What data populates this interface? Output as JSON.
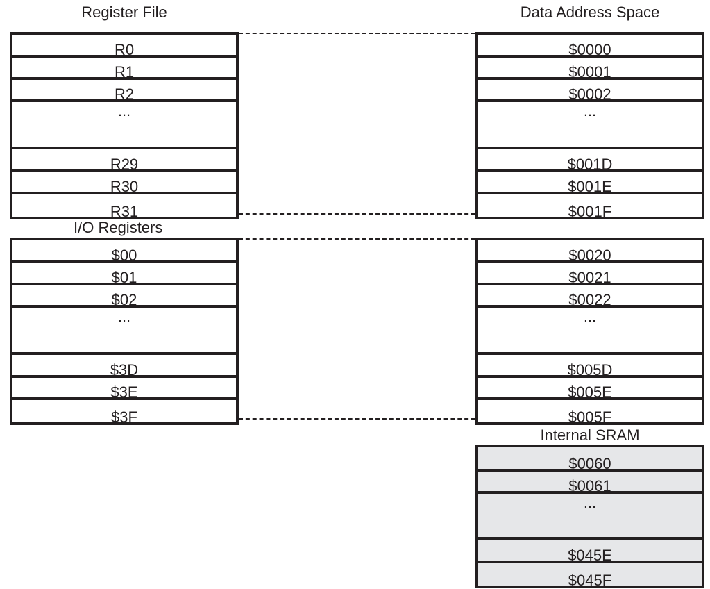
{
  "register_file": {
    "title": "Register File",
    "rows": [
      "R0",
      "R1",
      "R2",
      "...",
      "R29",
      "R30",
      "R31"
    ]
  },
  "io_registers": {
    "title": "I/O Registers",
    "rows": [
      "$00",
      "$01",
      "$02",
      "...",
      "$3D",
      "$3E",
      "$3F"
    ]
  },
  "data_address_space": {
    "title": "Data Address Space",
    "register_rows": [
      "$0000",
      "$0001",
      "$0002",
      "...",
      "$001D",
      "$001E",
      "$001F"
    ],
    "io_rows": [
      "$0020",
      "$0021",
      "$0022",
      "...",
      "$005D",
      "$005E",
      "$005F"
    ]
  },
  "internal_sram": {
    "title": "Internal SRAM",
    "rows": [
      "$0060",
      "$0061",
      "...",
      "$045E",
      "$045F"
    ],
    "fill_color": "#e6e7e9"
  }
}
